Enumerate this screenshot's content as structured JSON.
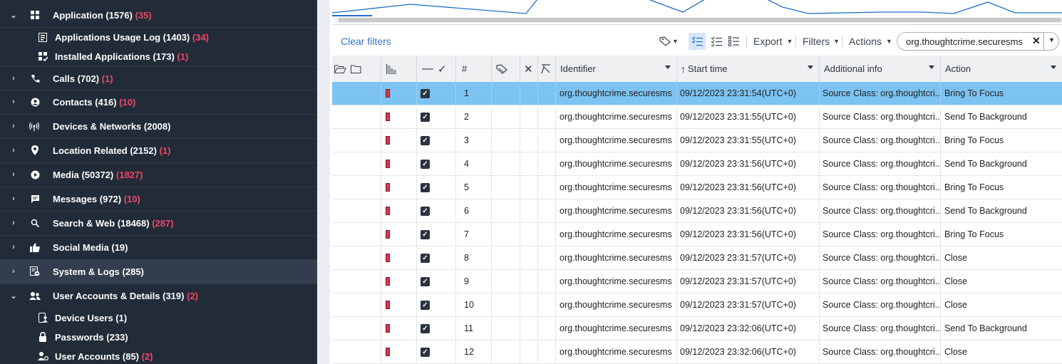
{
  "sidebar": {
    "categories": [
      {
        "label": "Application (1576)",
        "count": "(35)",
        "icon": "grid-icon",
        "expanded": true
      },
      {
        "label": "Calls (702)",
        "count": "(1)",
        "icon": "phone-icon"
      },
      {
        "label": "Contacts (416)",
        "count": "(10)",
        "icon": "contact-icon"
      },
      {
        "label": "Devices & Networks (2008)",
        "count": "",
        "icon": "antenna-icon"
      },
      {
        "label": "Location Related (2152)",
        "count": "(1)",
        "icon": "location-pin-icon"
      },
      {
        "label": "Media (50372)",
        "count": "(1827)",
        "icon": "play-icon"
      },
      {
        "label": "Messages (972)",
        "count": "(10)",
        "icon": "message-icon"
      },
      {
        "label": "Search & Web (18468)",
        "count": "(287)",
        "icon": "search-icon"
      },
      {
        "label": "Social Media (19)",
        "count": "",
        "icon": "thumbs-up-icon"
      },
      {
        "label": "System & Logs (285)",
        "count": "",
        "icon": "system-log-icon",
        "selected": true
      },
      {
        "label": "User Accounts & Details (319)",
        "count": "(2)",
        "icon": "users-icon",
        "expanded": true
      }
    ],
    "app_children": [
      {
        "label": "Applications Usage Log (1403)",
        "count": "(34)",
        "icon": "usage-log-icon"
      },
      {
        "label": "Installed Applications (173)",
        "count": "(1)",
        "icon": "installed-apps-icon"
      }
    ],
    "user_children": [
      {
        "label": "Device Users (1)",
        "count": "",
        "icon": "device-user-icon"
      },
      {
        "label": "Passwords (233)",
        "count": "",
        "icon": "lock-icon"
      },
      {
        "label": "User Accounts (85)",
        "count": "(2)",
        "icon": "user-account-icon"
      }
    ]
  },
  "toolbar": {
    "clear_filters": "Clear filters",
    "export": "Export",
    "filters": "Filters",
    "actions": "Actions",
    "search_value": "org.thoughtcrime.securesms"
  },
  "table": {
    "headers": {
      "number": "#",
      "identifier": "Identifier",
      "start_time": "Start time",
      "additional_info": "Additional info",
      "action": "Action"
    },
    "rows": [
      {
        "n": "1",
        "identifier": "org.thoughtcrime.securesms",
        "time": "09/12/2023 23:31:54(UTC+0)",
        "info": "Source Class: org.thoughtcri...",
        "action": "Bring To Focus",
        "selected": true
      },
      {
        "n": "2",
        "identifier": "org.thoughtcrime.securesms",
        "time": "09/12/2023 23:31:55(UTC+0)",
        "info": "Source Class: org.thoughtcri...",
        "action": "Send To Background"
      },
      {
        "n": "3",
        "identifier": "org.thoughtcrime.securesms",
        "time": "09/12/2023 23:31:55(UTC+0)",
        "info": "Source Class: org.thoughtcri...",
        "action": "Bring To Focus"
      },
      {
        "n": "4",
        "identifier": "org.thoughtcrime.securesms",
        "time": "09/12/2023 23:31:56(UTC+0)",
        "info": "Source Class: org.thoughtcri...",
        "action": "Send To Background"
      },
      {
        "n": "5",
        "identifier": "org.thoughtcrime.securesms",
        "time": "09/12/2023 23:31:56(UTC+0)",
        "info": "Source Class: org.thoughtcri...",
        "action": "Bring To Focus"
      },
      {
        "n": "6",
        "identifier": "org.thoughtcrime.securesms",
        "time": "09/12/2023 23:31:56(UTC+0)",
        "info": "Source Class: org.thoughtcri...",
        "action": "Send To Background"
      },
      {
        "n": "7",
        "identifier": "org.thoughtcrime.securesms",
        "time": "09/12/2023 23:31:56(UTC+0)",
        "info": "Source Class: org.thoughtcri...",
        "action": "Bring To Focus"
      },
      {
        "n": "8",
        "identifier": "org.thoughtcrime.securesms",
        "time": "09/12/2023 23:31:57(UTC+0)",
        "info": "Source Class: org.thoughtcri...",
        "action": "Close"
      },
      {
        "n": "9",
        "identifier": "org.thoughtcrime.securesms",
        "time": "09/12/2023 23:31:57(UTC+0)",
        "info": "Source Class: org.thoughtcri...",
        "action": "Close"
      },
      {
        "n": "10",
        "identifier": "org.thoughtcrime.securesms",
        "time": "09/12/2023 23:31:57(UTC+0)",
        "info": "Source Class: org.thoughtcri...",
        "action": "Close"
      },
      {
        "n": "11",
        "identifier": "org.thoughtcrime.securesms",
        "time": "09/12/2023 23:32:06(UTC+0)",
        "info": "Source Class: org.thoughtcri...",
        "action": "Send To Background"
      },
      {
        "n": "12",
        "identifier": "org.thoughtcrime.securesms",
        "time": "09/12/2023 23:32:06(UTC+0)",
        "info": "Source Class: org.thoughtcri...",
        "action": "Close"
      }
    ]
  },
  "colors": {
    "sidebar_bg": "#222b38",
    "count_red": "#ef4766",
    "selection_blue": "#7cc3f2",
    "link_blue": "#3573c8",
    "timeline_line": "#1f6fc5"
  }
}
